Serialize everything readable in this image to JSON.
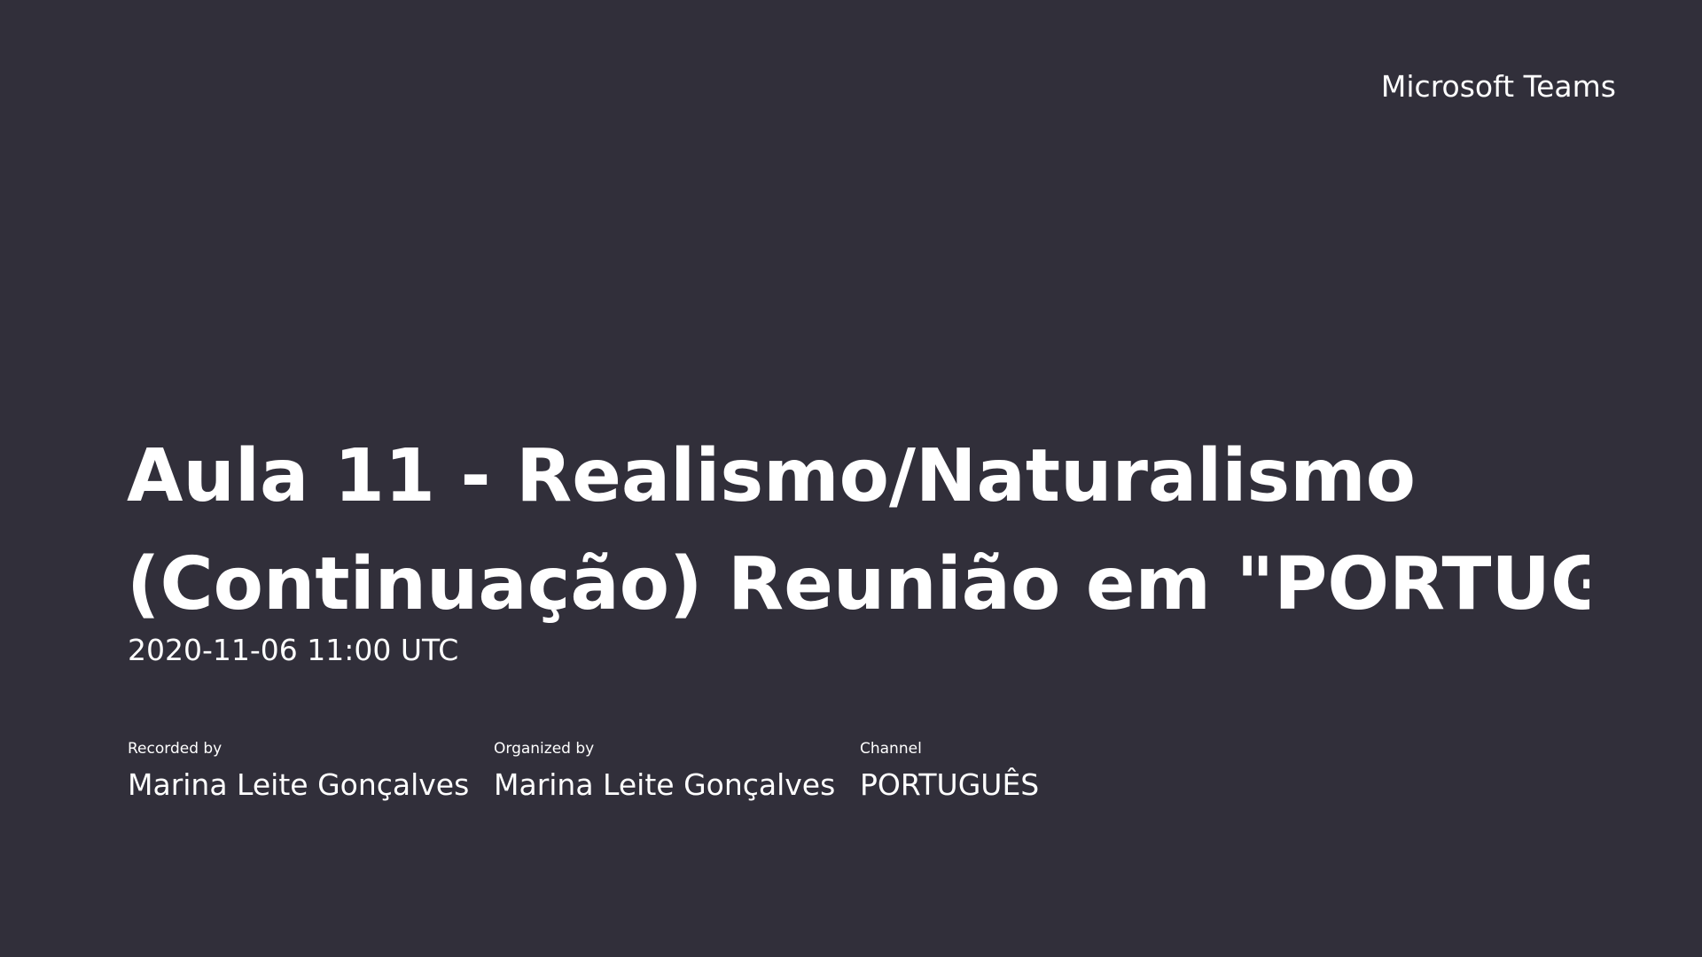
{
  "brand": "Microsoft Teams",
  "recording": {
    "title_line1": "Aula 11 - Realismo/Naturalismo",
    "title_line2": "(Continuação) Reunião em \"PORTUGU...",
    "datetime": "2020-11-06 11:00 UTC"
  },
  "meta": {
    "recorded_by_label": "Recorded by",
    "recorded_by_value": "Marina Leite Gonçalves",
    "organized_by_label": "Organized by",
    "organized_by_value": "Marina Leite Gonçalves",
    "channel_label": "Channel",
    "channel_value": "PORTUGUÊS"
  },
  "colors": {
    "background": "#312f3a",
    "text": "#ffffff"
  }
}
